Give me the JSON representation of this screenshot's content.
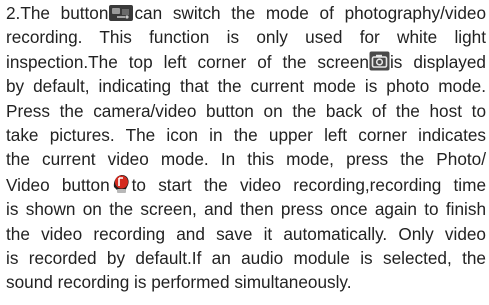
{
  "paragraph": {
    "lines": [
      {
        "a": "2.The button",
        "b": "can switch the mode of photography/video"
      },
      {
        "a": "recording.  This  function  is  only  used for white light"
      },
      {
        "a": "inspection.The top left corner of the screen",
        "b": "is displayed"
      },
      {
        "a": "by default, indicating that the current mode is photo mode."
      },
      {
        "a": "Press the camera/video button on the  back of the host to"
      },
      {
        "a": "take  pictures.  The  icon  in the upper left corner indicates"
      },
      {
        "a": "the  current  video  mode. In  this  mode, press the Photo/"
      },
      {
        "a": "Video button",
        "b": "to start the video recording,recording time"
      },
      {
        "a": "is shown on the screen, and then press once again to finish"
      },
      {
        "a": "the  video  recording and save it automatically. Only video"
      },
      {
        "a": "is  recorded  by default.If an audio module is selected, the"
      },
      {
        "a": "sound recording is performed simultaneously."
      }
    ]
  },
  "icons": {
    "mode_switch": "mode-switch-icon",
    "camera": "camera-icon",
    "record": "record-button-icon"
  },
  "colors": {
    "text": "#222222",
    "icon_dark": "#3a3a3a",
    "record_red": "#d42a1f"
  }
}
